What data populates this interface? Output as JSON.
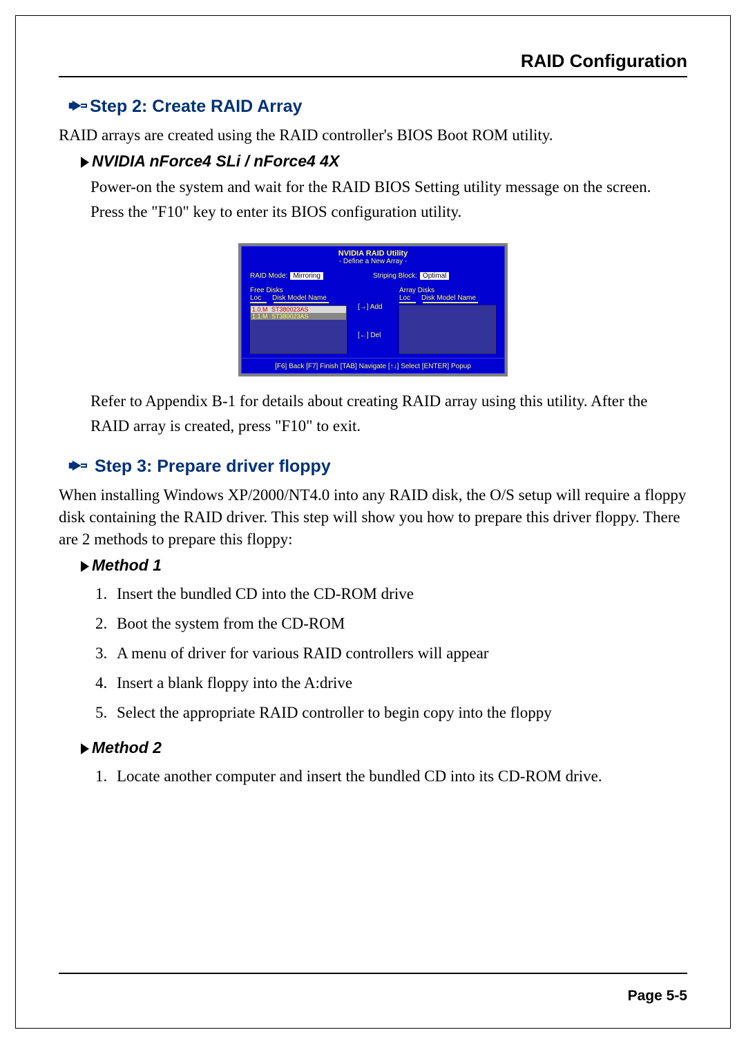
{
  "header": {
    "title": "RAID Configuration"
  },
  "step2": {
    "heading": "Step 2: Create RAID Array",
    "intro": "RAID arrays are created using the RAID controller's BIOS Boot ROM utility.",
    "subheading": "NVIDIA nForce4 SLi / nForce4 4X",
    "para1": "Power-on the system and wait for the RAID BIOS Setting utility message on the screen.  Press the \"F10\" key to enter its BIOS configuration utility.",
    "bios": {
      "title": "NVIDIA RAID Utility",
      "subtitle": "-  Define a New Array  -",
      "raidmode_label": "RAID Mode:",
      "raidmode_value": "Mirroring",
      "stripe_label": "Striping Block:",
      "stripe_value": "Optimal",
      "free_disks_label": "Free Disks",
      "array_disks_label": "Array Disks",
      "col_loc": "Loc",
      "col_model": "Disk Model Name",
      "disks": [
        {
          "loc": "1.0.M",
          "model": "ST380023AS"
        },
        {
          "loc": "1.1.M",
          "model": "ST380023AS"
        }
      ],
      "add_label": "[→] Add",
      "del_label": "[←] Del",
      "footer": "[F6] Back  [F7] Finish  [TAB] Navigate  [↑↓] Select  [ENTER] Popup"
    },
    "para2": "Refer to Appendix B-1 for details about creating RAID array using this utility. After the RAID array is created, press \"F10\" to exit."
  },
  "step3": {
    "heading": "Step 3: Prepare driver floppy",
    "intro": "When installing Windows XP/2000/NT4.0 into any RAID disk, the O/S setup will require a floppy disk containing the RAID driver. This step will show you how to prepare this driver floppy. There are 2 methods to prepare this floppy:",
    "method1_heading": "Method 1",
    "method1_items": [
      "Insert the bundled CD into the CD-ROM drive",
      "Boot the system from the CD-ROM",
      "A menu of driver for various RAID controllers will appear",
      "Insert a blank floppy into the A:drive",
      "Select the appropriate RAID controller to begin copy into the floppy"
    ],
    "method2_heading": "Method 2",
    "method2_items": [
      "Locate another computer and insert the bundled CD into its CD-ROM drive."
    ]
  },
  "footer": {
    "page": "Page 5-5"
  }
}
